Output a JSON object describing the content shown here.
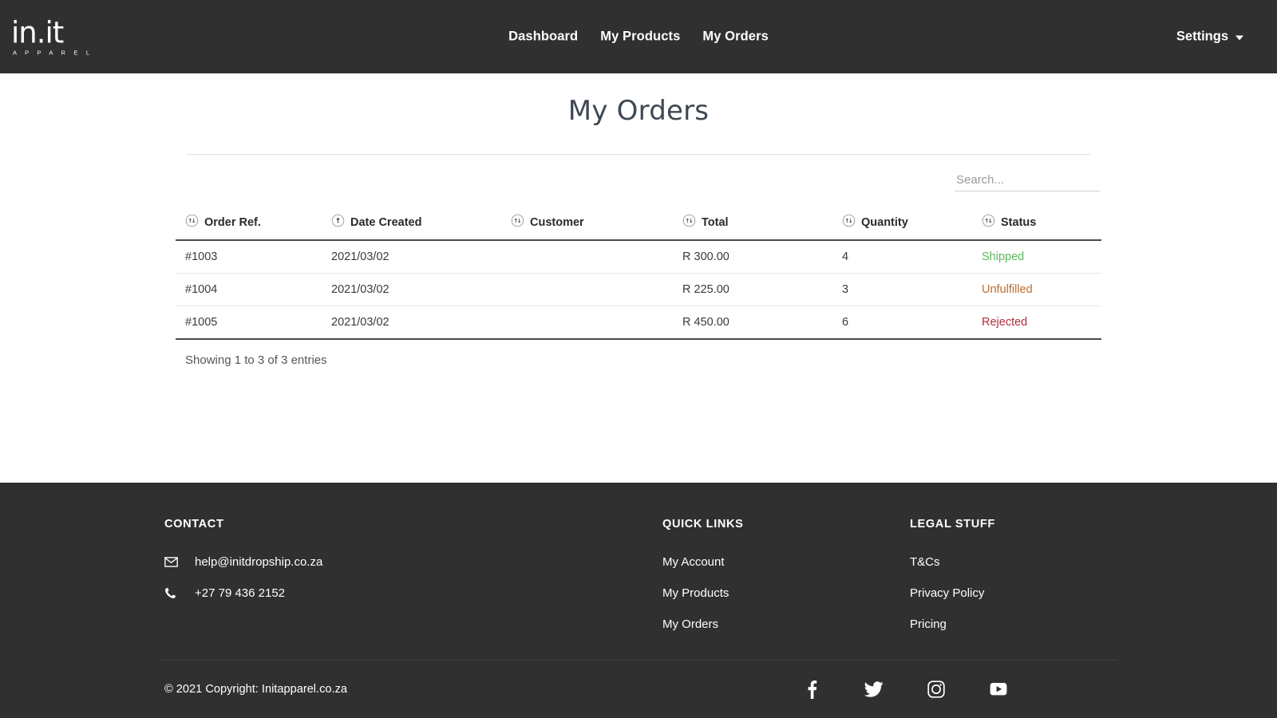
{
  "navbar": {
    "brand": {
      "mark": "in.it",
      "sub": "A P P A R E L"
    },
    "links": [
      {
        "label": "Dashboard"
      },
      {
        "label": "My Products"
      },
      {
        "label": "My Orders"
      }
    ],
    "settings": {
      "label": "Settings",
      "caret": "chevron-down-icon"
    }
  },
  "page": {
    "title": "My Orders"
  },
  "search": {
    "placeholder": "Search...",
    "value": ""
  },
  "table": {
    "columns": [
      {
        "label": "Order Ref.",
        "sort": "none"
      },
      {
        "label": "Date Created",
        "sort": "asc"
      },
      {
        "label": "Customer",
        "sort": "none"
      },
      {
        "label": "Total",
        "sort": "none"
      },
      {
        "label": "Quantity",
        "sort": "none"
      },
      {
        "label": "Status",
        "sort": "none"
      }
    ],
    "rows": [
      {
        "order_ref": "#1003",
        "date_created": "2021/03/02",
        "customer": "",
        "total": "R 300.00",
        "quantity": "4",
        "status": "Shipped",
        "status_color": "#5cb85c"
      },
      {
        "order_ref": "#1004",
        "date_created": "2021/03/02",
        "customer": "",
        "total": "R 225.00",
        "quantity": "3",
        "status": "Unfulfilled",
        "status_color": "#bf6c2c"
      },
      {
        "order_ref": "#1005",
        "date_created": "2021/03/02",
        "customer": "",
        "total": "R 450.00",
        "quantity": "6",
        "status": "Rejected",
        "status_color": "#b32d3f"
      }
    ],
    "entries_info": "Showing 1 to 3 of 3 entries"
  },
  "footer": {
    "contact": {
      "heading": "CONTACT",
      "email": "help@initdropship.co.za",
      "email_icon": "envelope-icon",
      "phone": "+27 79 436 2152",
      "phone_icon": "phone-icon"
    },
    "quick_links": {
      "heading": "QUICK LINKS",
      "items": [
        {
          "label": "My Account"
        },
        {
          "label": "My Products"
        },
        {
          "label": "My Orders"
        }
      ]
    },
    "legal": {
      "heading": "LEGAL STUFF",
      "items": [
        {
          "label": "T&Cs"
        },
        {
          "label": "Privacy Policy"
        },
        {
          "label": "Pricing"
        }
      ]
    },
    "copyright": "© 2021 Copyright: Initapparel.co.za",
    "socials": [
      {
        "name": "facebook-icon"
      },
      {
        "name": "twitter-icon"
      },
      {
        "name": "instagram-icon"
      },
      {
        "name": "youtube-icon"
      }
    ]
  },
  "colors": {
    "nav_bg": "#303030",
    "page_title": "#3e4852",
    "status_shipped": "#5cb85c",
    "status_unfulfilled": "#bf6c2c",
    "status_rejected": "#b32d3f"
  }
}
